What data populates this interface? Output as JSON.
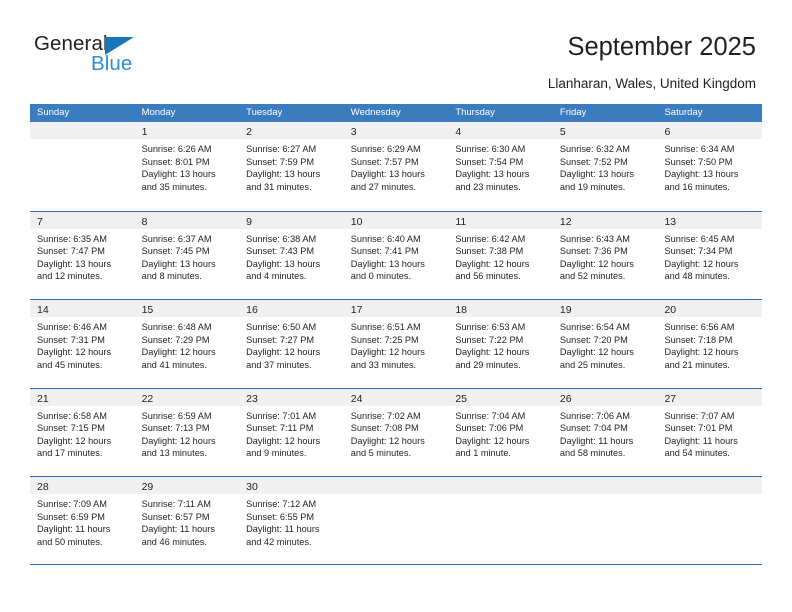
{
  "brand": {
    "name_part1": "General",
    "name_part2": "Blue",
    "flag_color": "#1b75bb",
    "blue_color": "#2e8ece"
  },
  "header": {
    "title": "September 2025",
    "subtitle": "Llanharan, Wales, United Kingdom"
  },
  "theme": {
    "header_row_bg": "#3a7cbe",
    "week_divider": "#2e6da4",
    "daynum_strip_bg": "#f0f0f0",
    "text": "#231f20"
  },
  "calendar": {
    "weekdays": [
      "Sunday",
      "Monday",
      "Tuesday",
      "Wednesday",
      "Thursday",
      "Friday",
      "Saturday"
    ],
    "weeks": [
      [
        {
          "day": "",
          "lines": []
        },
        {
          "day": "1",
          "lines": [
            "Sunrise: 6:26 AM",
            "Sunset: 8:01 PM",
            "Daylight: 13 hours",
            "and 35 minutes."
          ]
        },
        {
          "day": "2",
          "lines": [
            "Sunrise: 6:27 AM",
            "Sunset: 7:59 PM",
            "Daylight: 13 hours",
            "and 31 minutes."
          ]
        },
        {
          "day": "3",
          "lines": [
            "Sunrise: 6:29 AM",
            "Sunset: 7:57 PM",
            "Daylight: 13 hours",
            "and 27 minutes."
          ]
        },
        {
          "day": "4",
          "lines": [
            "Sunrise: 6:30 AM",
            "Sunset: 7:54 PM",
            "Daylight: 13 hours",
            "and 23 minutes."
          ]
        },
        {
          "day": "5",
          "lines": [
            "Sunrise: 6:32 AM",
            "Sunset: 7:52 PM",
            "Daylight: 13 hours",
            "and 19 minutes."
          ]
        },
        {
          "day": "6",
          "lines": [
            "Sunrise: 6:34 AM",
            "Sunset: 7:50 PM",
            "Daylight: 13 hours",
            "and 16 minutes."
          ]
        }
      ],
      [
        {
          "day": "7",
          "lines": [
            "Sunrise: 6:35 AM",
            "Sunset: 7:47 PM",
            "Daylight: 13 hours",
            "and 12 minutes."
          ]
        },
        {
          "day": "8",
          "lines": [
            "Sunrise: 6:37 AM",
            "Sunset: 7:45 PM",
            "Daylight: 13 hours",
            "and 8 minutes."
          ]
        },
        {
          "day": "9",
          "lines": [
            "Sunrise: 6:38 AM",
            "Sunset: 7:43 PM",
            "Daylight: 13 hours",
            "and 4 minutes."
          ]
        },
        {
          "day": "10",
          "lines": [
            "Sunrise: 6:40 AM",
            "Sunset: 7:41 PM",
            "Daylight: 13 hours",
            "and 0 minutes."
          ]
        },
        {
          "day": "11",
          "lines": [
            "Sunrise: 6:42 AM",
            "Sunset: 7:38 PM",
            "Daylight: 12 hours",
            "and 56 minutes."
          ]
        },
        {
          "day": "12",
          "lines": [
            "Sunrise: 6:43 AM",
            "Sunset: 7:36 PM",
            "Daylight: 12 hours",
            "and 52 minutes."
          ]
        },
        {
          "day": "13",
          "lines": [
            "Sunrise: 6:45 AM",
            "Sunset: 7:34 PM",
            "Daylight: 12 hours",
            "and 48 minutes."
          ]
        }
      ],
      [
        {
          "day": "14",
          "lines": [
            "Sunrise: 6:46 AM",
            "Sunset: 7:31 PM",
            "Daylight: 12 hours",
            "and 45 minutes."
          ]
        },
        {
          "day": "15",
          "lines": [
            "Sunrise: 6:48 AM",
            "Sunset: 7:29 PM",
            "Daylight: 12 hours",
            "and 41 minutes."
          ]
        },
        {
          "day": "16",
          "lines": [
            "Sunrise: 6:50 AM",
            "Sunset: 7:27 PM",
            "Daylight: 12 hours",
            "and 37 minutes."
          ]
        },
        {
          "day": "17",
          "lines": [
            "Sunrise: 6:51 AM",
            "Sunset: 7:25 PM",
            "Daylight: 12 hours",
            "and 33 minutes."
          ]
        },
        {
          "day": "18",
          "lines": [
            "Sunrise: 6:53 AM",
            "Sunset: 7:22 PM",
            "Daylight: 12 hours",
            "and 29 minutes."
          ]
        },
        {
          "day": "19",
          "lines": [
            "Sunrise: 6:54 AM",
            "Sunset: 7:20 PM",
            "Daylight: 12 hours",
            "and 25 minutes."
          ]
        },
        {
          "day": "20",
          "lines": [
            "Sunrise: 6:56 AM",
            "Sunset: 7:18 PM",
            "Daylight: 12 hours",
            "and 21 minutes."
          ]
        }
      ],
      [
        {
          "day": "21",
          "lines": [
            "Sunrise: 6:58 AM",
            "Sunset: 7:15 PM",
            "Daylight: 12 hours",
            "and 17 minutes."
          ]
        },
        {
          "day": "22",
          "lines": [
            "Sunrise: 6:59 AM",
            "Sunset: 7:13 PM",
            "Daylight: 12 hours",
            "and 13 minutes."
          ]
        },
        {
          "day": "23",
          "lines": [
            "Sunrise: 7:01 AM",
            "Sunset: 7:11 PM",
            "Daylight: 12 hours",
            "and 9 minutes."
          ]
        },
        {
          "day": "24",
          "lines": [
            "Sunrise: 7:02 AM",
            "Sunset: 7:08 PM",
            "Daylight: 12 hours",
            "and 5 minutes."
          ]
        },
        {
          "day": "25",
          "lines": [
            "Sunrise: 7:04 AM",
            "Sunset: 7:06 PM",
            "Daylight: 12 hours",
            "and 1 minute."
          ]
        },
        {
          "day": "26",
          "lines": [
            "Sunrise: 7:06 AM",
            "Sunset: 7:04 PM",
            "Daylight: 11 hours",
            "and 58 minutes."
          ]
        },
        {
          "day": "27",
          "lines": [
            "Sunrise: 7:07 AM",
            "Sunset: 7:01 PM",
            "Daylight: 11 hours",
            "and 54 minutes."
          ]
        }
      ],
      [
        {
          "day": "28",
          "lines": [
            "Sunrise: 7:09 AM",
            "Sunset: 6:59 PM",
            "Daylight: 11 hours",
            "and 50 minutes."
          ]
        },
        {
          "day": "29",
          "lines": [
            "Sunrise: 7:11 AM",
            "Sunset: 6:57 PM",
            "Daylight: 11 hours",
            "and 46 minutes."
          ]
        },
        {
          "day": "30",
          "lines": [
            "Sunrise: 7:12 AM",
            "Sunset: 6:55 PM",
            "Daylight: 11 hours",
            "and 42 minutes."
          ]
        },
        {
          "day": "",
          "lines": []
        },
        {
          "day": "",
          "lines": []
        },
        {
          "day": "",
          "lines": []
        },
        {
          "day": "",
          "lines": []
        }
      ]
    ]
  }
}
